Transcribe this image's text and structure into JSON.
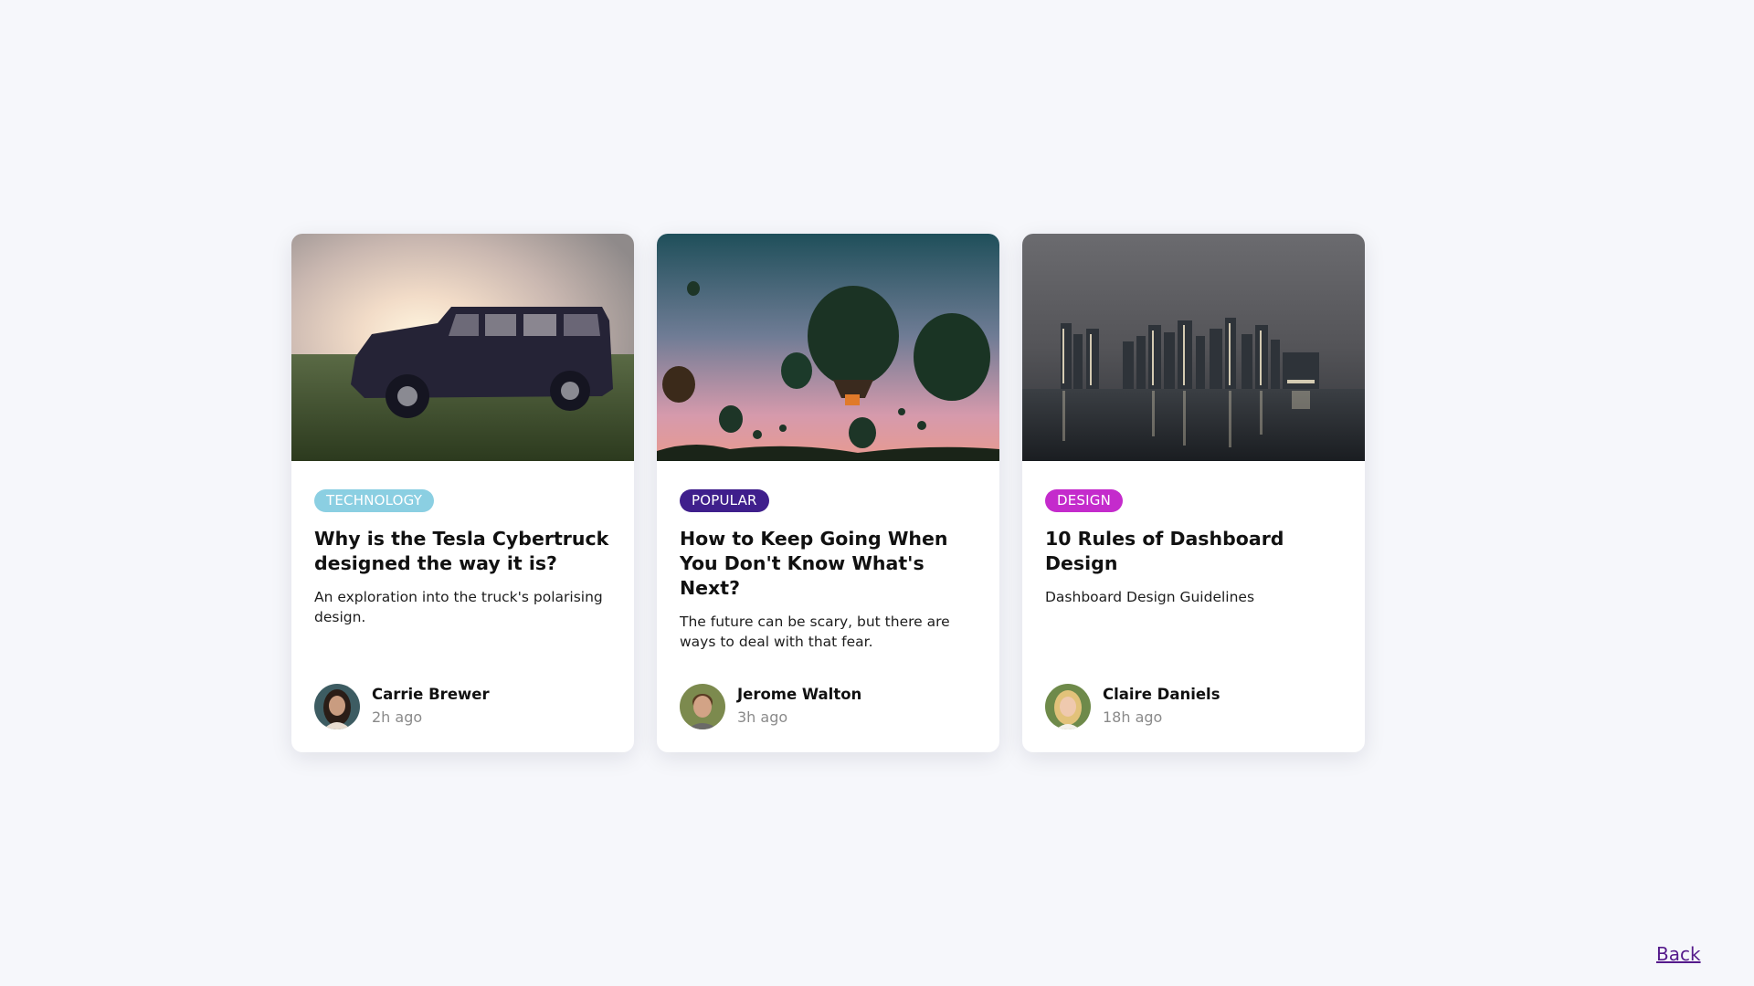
{
  "cards": [
    {
      "tag": "TECHNOLOGY",
      "tag_color": "#8bcfe2",
      "title": "Why is the Tesla Cybertruck designed the way it is?",
      "description": "An exploration into the truck's polarising design.",
      "author": "Carrie Brewer",
      "time": "2h ago",
      "image_icon": "truck-sunset-photo",
      "avatar_icon": "woman-dark-hair-avatar"
    },
    {
      "tag": "POPULAR",
      "tag_color": "#3f1f8c",
      "title": "How to Keep Going When You Don't Know What's Next?",
      "description": "The future can be scary, but there are ways to deal with that fear.",
      "author": "Jerome Walton",
      "time": "3h ago",
      "image_icon": "hot-air-balloons-photo",
      "avatar_icon": "man-short-hair-avatar"
    },
    {
      "tag": "DESIGN",
      "tag_color": "#c42bcc",
      "title": "10 Rules of Dashboard Design",
      "description": "Dashboard Design Guidelines",
      "author": "Claire Daniels",
      "time": "18h ago",
      "image_icon": "city-skyline-night-photo",
      "avatar_icon": "woman-blonde-avatar"
    }
  ],
  "footer": {
    "back_label": "Back"
  }
}
